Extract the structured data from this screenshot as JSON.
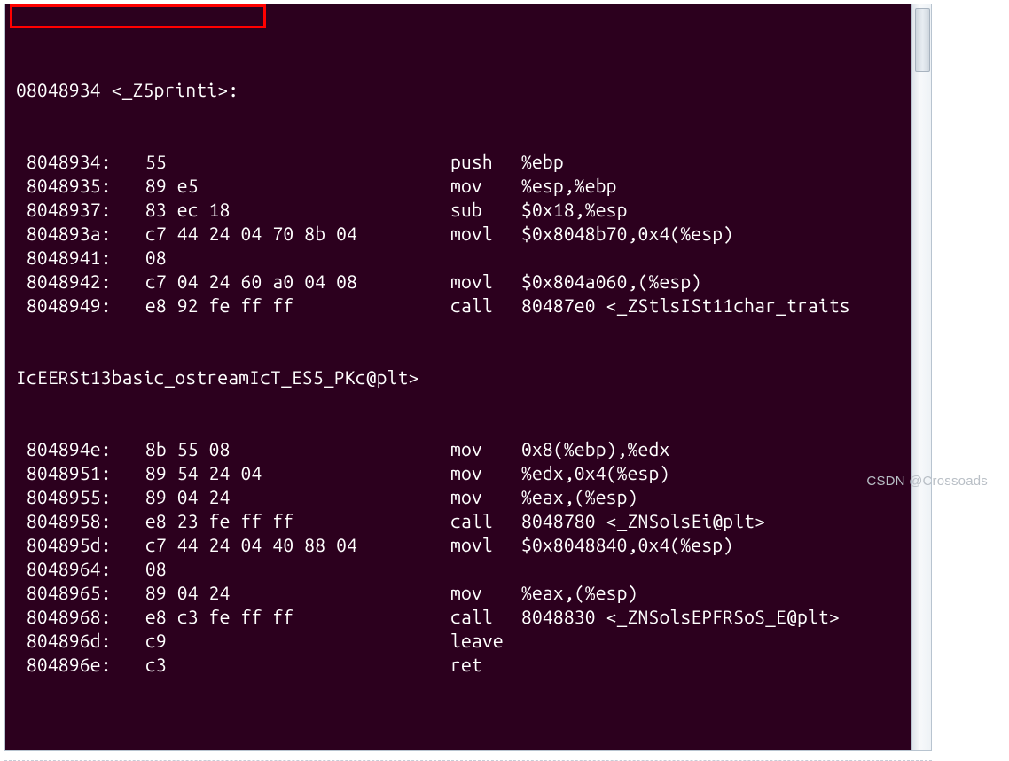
{
  "header": "08048934 <_Z5printi>:",
  "rows": [
    {
      "addr": " 8048934:",
      "hex": "55",
      "mn": "push",
      "op": "%ebp"
    },
    {
      "addr": " 8048935:",
      "hex": "89 e5",
      "mn": "mov",
      "op": "%esp,%ebp"
    },
    {
      "addr": " 8048937:",
      "hex": "83 ec 18",
      "mn": "sub",
      "op": "$0x18,%esp"
    },
    {
      "addr": " 804893a:",
      "hex": "c7 44 24 04 70 8b 04",
      "mn": "movl",
      "op": "$0x8048b70,0x4(%esp)"
    },
    {
      "addr": " 8048941:",
      "hex": "08",
      "mn": "",
      "op": ""
    },
    {
      "addr": " 8048942:",
      "hex": "c7 04 24 60 a0 04 08",
      "mn": "movl",
      "op": "$0x804a060,(%esp)"
    },
    {
      "addr": " 8048949:",
      "hex": "e8 92 fe ff ff",
      "mn": "call",
      "op": "80487e0 <_ZStlsISt11char_traits"
    }
  ],
  "wrap": "IcEERSt13basic_ostreamIcT_ES5_PKc@plt>",
  "rows2": [
    {
      "addr": " 804894e:",
      "hex": "8b 55 08",
      "mn": "mov",
      "op": "0x8(%ebp),%edx"
    },
    {
      "addr": " 8048951:",
      "hex": "89 54 24 04",
      "mn": "mov",
      "op": "%edx,0x4(%esp)"
    },
    {
      "addr": " 8048955:",
      "hex": "89 04 24",
      "mn": "mov",
      "op": "%eax,(%esp)"
    },
    {
      "addr": " 8048958:",
      "hex": "e8 23 fe ff ff",
      "mn": "call",
      "op": "8048780 <_ZNSolsEi@plt>"
    },
    {
      "addr": " 804895d:",
      "hex": "c7 44 24 04 40 88 04",
      "mn": "movl",
      "op": "$0x8048840,0x4(%esp)"
    },
    {
      "addr": " 8048964:",
      "hex": "08",
      "mn": "",
      "op": ""
    },
    {
      "addr": " 8048965:",
      "hex": "89 04 24",
      "mn": "mov",
      "op": "%eax,(%esp)"
    },
    {
      "addr": " 8048968:",
      "hex": "e8 c3 fe ff ff",
      "mn": "call",
      "op": "8048830 <_ZNSolsEPFRSoS_E@plt>"
    },
    {
      "addr": " 804896d:",
      "hex": "c9",
      "mn": "leave",
      "op": ""
    },
    {
      "addr": " 804896e:",
      "hex": "c3",
      "mn": "ret",
      "op": ""
    }
  ],
  "watermark": "CSDN @Crossoads"
}
